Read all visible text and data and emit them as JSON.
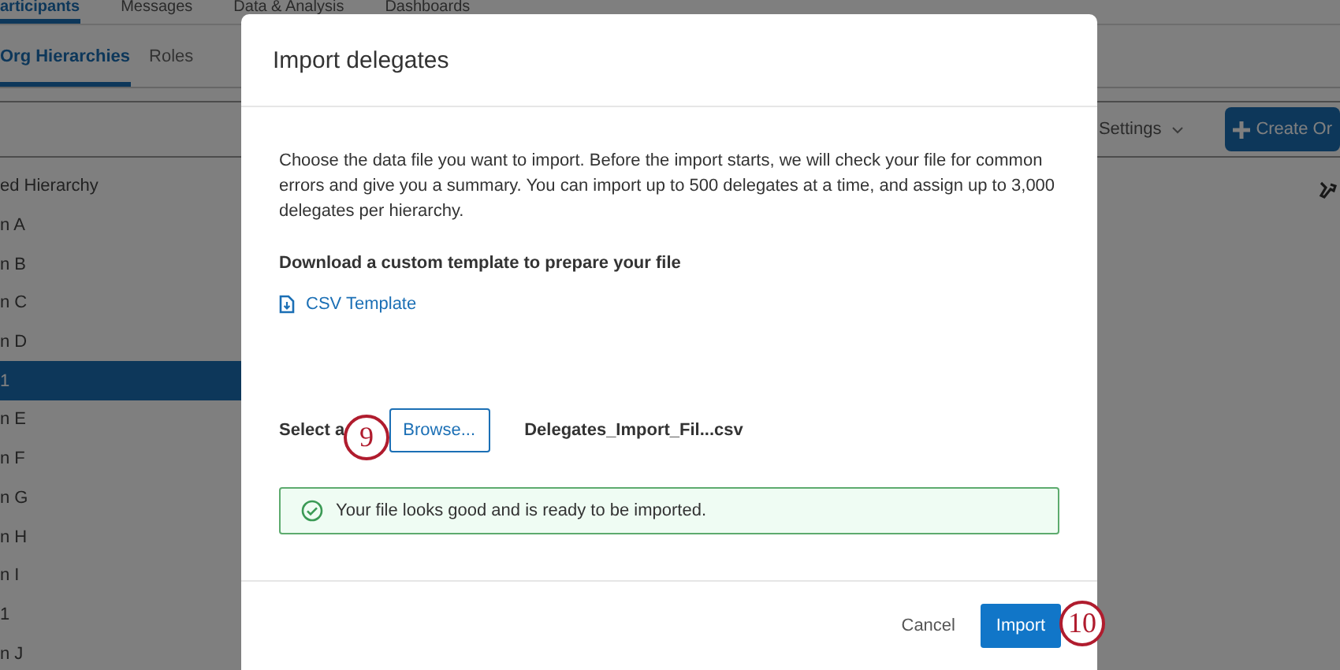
{
  "top_nav": [
    {
      "label": "articipants",
      "selected": true
    },
    {
      "label": "Messages",
      "selected": false
    },
    {
      "label": "Data & Analysis",
      "selected": false
    },
    {
      "label": "Dashboards",
      "selected": false
    }
  ],
  "sub_tabs": [
    {
      "label": "Org Hierarchies",
      "selected": true
    },
    {
      "label": "Roles",
      "selected": false
    }
  ],
  "toolbar": {
    "settings": "Settings",
    "create_button": "Create Or"
  },
  "hierarchy_list": [
    {
      "label": "ed Hierarchy",
      "selected": false
    },
    {
      "label": "n A",
      "selected": false
    },
    {
      "label": "n B",
      "selected": false
    },
    {
      "label": "n C",
      "selected": false
    },
    {
      "label": "n D",
      "selected": false
    },
    {
      "label": "1",
      "selected": true
    },
    {
      "label": "n E",
      "selected": false
    },
    {
      "label": "n F",
      "selected": false
    },
    {
      "label": "n G",
      "selected": false
    },
    {
      "label": "n H",
      "selected": false
    },
    {
      "label": "n I",
      "selected": false
    },
    {
      "label": "1",
      "selected": false
    },
    {
      "label": "n J",
      "selected": false
    }
  ],
  "dialog": {
    "title": "Import delegates",
    "description": "Choose the data file you want to import. Before the import starts, we will check your file for common errors and give you a summary. You can import up to 500 delegates at a time, and assign up to 3,000 delegates per hierarchy.",
    "template_heading": "Download a custom template to prepare your file",
    "template_link": "CSV Template",
    "select_label": "Select a",
    "browse_button": "Browse...",
    "file_name": "Delegates_Import_Fil...csv",
    "success_message": "Your file looks good and is ready to be imported.",
    "cancel_button": "Cancel",
    "import_button": "Import"
  },
  "callouts": [
    {
      "number": "9"
    },
    {
      "number": "10"
    }
  ]
}
